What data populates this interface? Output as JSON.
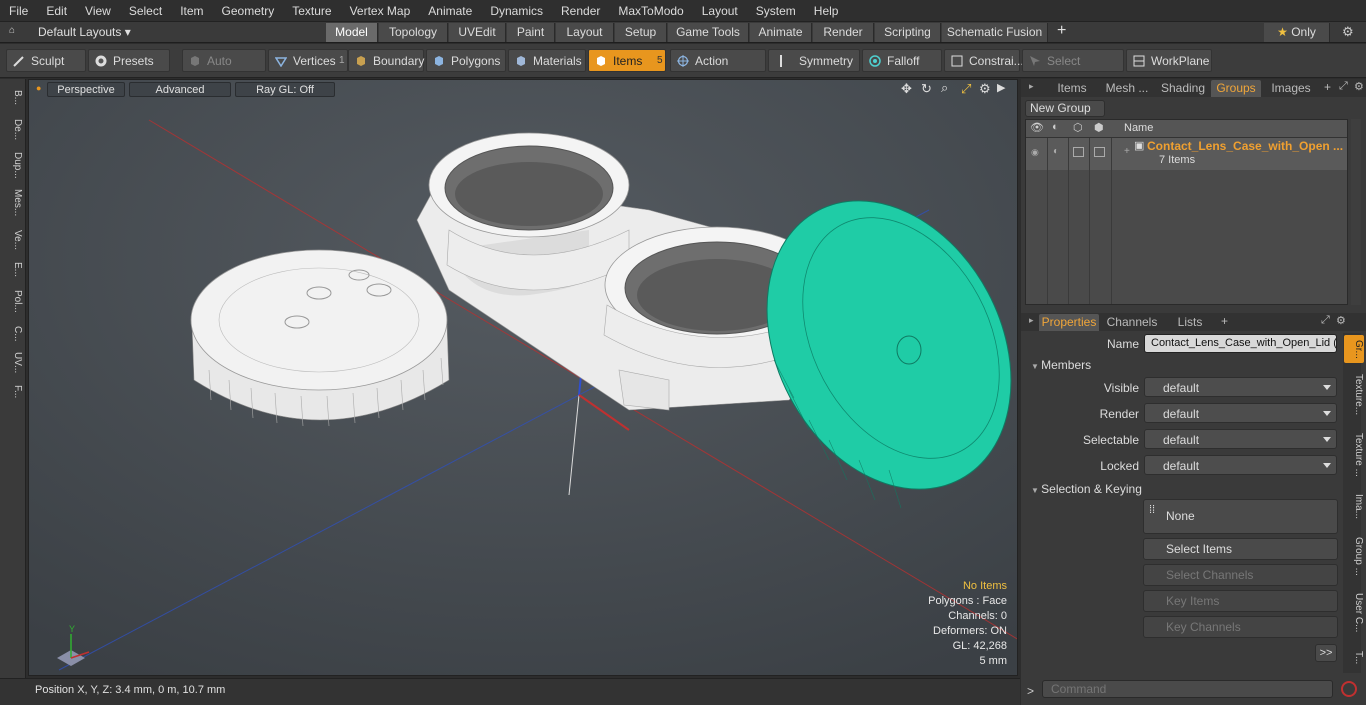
{
  "menu": [
    "File",
    "Edit",
    "View",
    "Select",
    "Item",
    "Geometry",
    "Texture",
    "Vertex Map",
    "Animate",
    "Dynamics",
    "Render",
    "MaxToModo",
    "Layout",
    "System",
    "Help"
  ],
  "layout_bar": {
    "layouts_label": "Default Layouts",
    "tabs": [
      "Model",
      "Topology",
      "UVEdit",
      "Paint",
      "Layout",
      "Setup",
      "Game Tools",
      "Animate",
      "Render",
      "Scripting",
      "Schematic Fusion"
    ],
    "add": "+",
    "only": "Only",
    "gear": "⚙"
  },
  "toolbar": {
    "sculpt": "Sculpt",
    "presets": "Presets",
    "auto_select": "Auto Select",
    "vertices": "Vertices",
    "vertices_count": "1",
    "boundary": "Boundary",
    "polygons": "Polygons",
    "materials": "Materials",
    "items": "Items",
    "items_count": "5",
    "action_center": "Action Center",
    "symmetry": "Symmetry",
    "falloff": "Falloff",
    "constraints": "Constrai...",
    "select_through": "Select Through",
    "workplane": "WorkPlane"
  },
  "left_strip": [
    "B...",
    "De...",
    "Dup...",
    "Mes...",
    "Ve...",
    "E...",
    "Pol...",
    "C...",
    "UV...",
    "F..."
  ],
  "viewport": {
    "perspective": "Perspective",
    "advanced": "Advanced",
    "raygl": "Ray GL: Off",
    "info": {
      "items": "No Items",
      "polygons": "Polygons : Face",
      "channels": "Channels: 0",
      "deformers": "Deformers: ON",
      "gl": "GL: 42,268",
      "scale": "5 mm"
    }
  },
  "status": {
    "position": "Position X, Y, Z:   3.4 mm, 0 m, 10.7 mm"
  },
  "groups_panel": {
    "tabs": [
      "Items",
      "Mesh ...",
      "Shading",
      "Groups",
      "Images"
    ],
    "new_group": "New Group",
    "name_col": "Name",
    "group_name": "Contact_Lens_Case_with_Open ...",
    "group_count": "7 Items"
  },
  "props_panel": {
    "tabs": [
      "Properties",
      "Channels",
      "Lists"
    ],
    "name_label": "Name",
    "name_value": "Contact_Lens_Case_with_Open_Lid (",
    "members": "Members",
    "visible_label": "Visible",
    "render_label": "Render",
    "selectable_label": "Selectable",
    "locked_label": "Locked",
    "default": "default",
    "sel_keying": "Selection & Keying",
    "none": "None",
    "select_items": "Select Items",
    "select_channels": "Select Channels",
    "key_items": "Key Items",
    "key_channels": "Key Channels",
    "more": ">>",
    "side_tabs": [
      "Gr...",
      "Texture...",
      "Texture ...",
      "Ima...",
      "Group ...",
      "User C...",
      "T..."
    ]
  },
  "command": {
    "placeholder": "Command",
    "prompt": ">"
  },
  "colors": {
    "accent": "#e8961e",
    "selected_mesh": "#1fcca6",
    "viewport_bg": "#484d52"
  }
}
